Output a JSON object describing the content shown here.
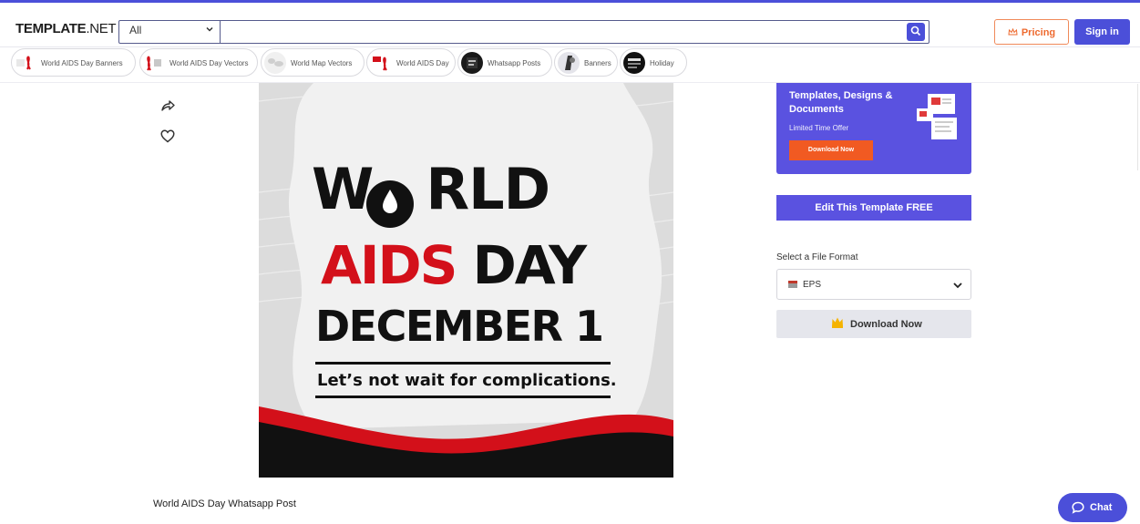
{
  "header": {
    "logo_main": "TEMPLATE",
    "logo_suffix": ".NET",
    "search_category": "All",
    "search_placeholder": "",
    "pricing_label": "Pricing",
    "signin_label": "Sign in"
  },
  "chips": [
    {
      "label": "World AIDS Day Banners",
      "icon": "red-ribbon-thumb"
    },
    {
      "label": "World AIDS Day Vectors",
      "icon": "aids-vector-thumb"
    },
    {
      "label": "World Map Vectors",
      "icon": "world-map-thumb"
    },
    {
      "label": "World AIDS Day",
      "icon": "aids-day-thumb"
    },
    {
      "label": "Whatsapp Posts",
      "icon": "whatsapp-post-thumb"
    },
    {
      "label": "Banners",
      "icon": "banner-thumb"
    },
    {
      "label": "Holiday",
      "icon": "holiday-thumb"
    }
  ],
  "poster": {
    "line1": "W",
    "line1_rest": "RLD",
    "line2_red": "AIDS",
    "line2_black": "DAY",
    "line3": "DECEMBER 1",
    "tagline": "Let’s not wait for complications.",
    "colors": {
      "red": "#d3101a",
      "black": "#111111",
      "background": "#dcdcdc"
    }
  },
  "promo": {
    "heading": "Templates, Designs & Documents",
    "subtext": "Limited Time Offer",
    "button": "Download Now"
  },
  "edit_button": "Edit This Template FREE",
  "format": {
    "label": "Select a File Format",
    "selected": "EPS"
  },
  "download_button": "Download Now",
  "caption": "World AIDS Day Whatsapp Post",
  "chat_label": "Chat",
  "accent_color": "#4b4fd9"
}
